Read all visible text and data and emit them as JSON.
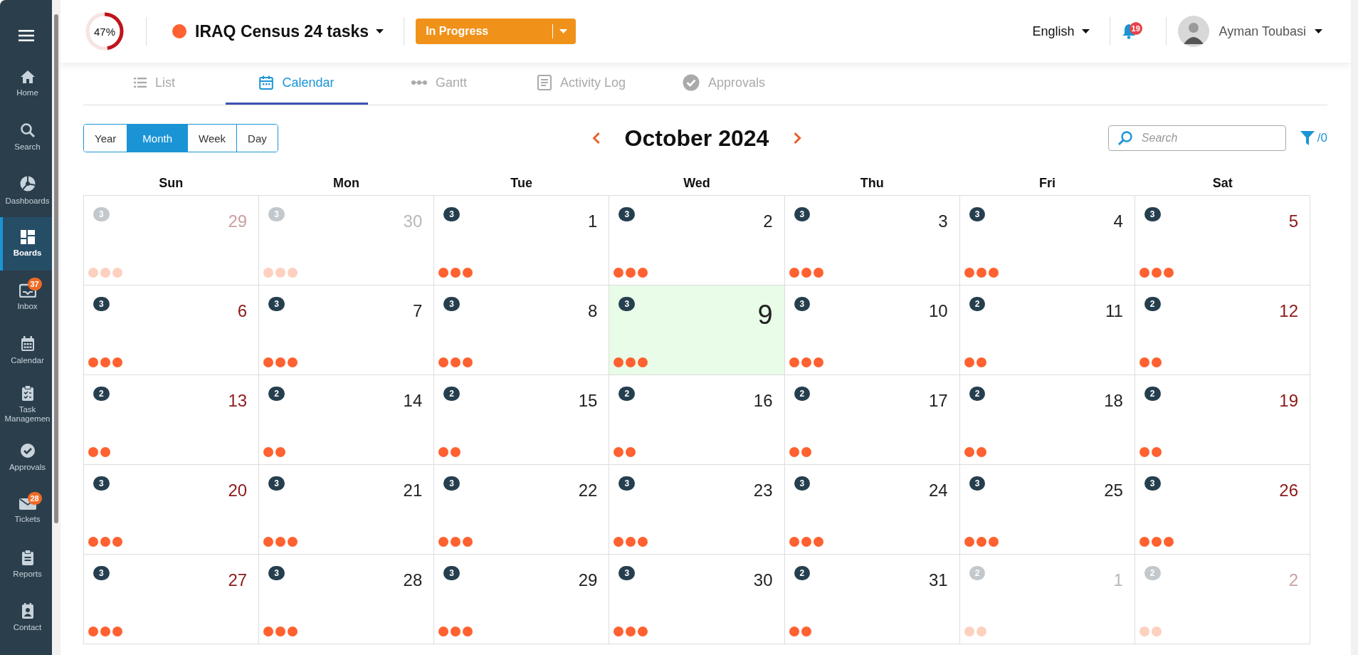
{
  "sidebar": {
    "items": [
      {
        "kind": "home",
        "label": "Home",
        "selected": false
      },
      {
        "kind": "search",
        "label": "Search",
        "selected": false
      },
      {
        "kind": "pie",
        "label": "Dashboards",
        "selected": false
      },
      {
        "kind": "boards",
        "label": "Boards",
        "selected": true
      },
      {
        "kind": "inbox",
        "label": "Inbox",
        "selected": false,
        "badge": "37"
      },
      {
        "kind": "calendar",
        "label": "Calendar",
        "selected": false
      },
      {
        "kind": "clipboard",
        "label": "Task Managemen",
        "selected": false
      },
      {
        "kind": "check",
        "label": "Approvals",
        "selected": false
      },
      {
        "kind": "mail",
        "label": "Tickets",
        "selected": false,
        "badge": "28"
      },
      {
        "kind": "report",
        "label": "Reports",
        "selected": false
      },
      {
        "kind": "contact",
        "label": "Contact",
        "selected": false
      }
    ]
  },
  "header": {
    "progress": {
      "level": 0.47,
      "text": "47%"
    },
    "project": {
      "title": "IRAQ Census 24 tasks",
      "color": "#ff6130"
    },
    "status": "In Progress",
    "language": "English",
    "notifications": "19",
    "user": "Ayman Toubasi"
  },
  "tabs": [
    {
      "kind": "list",
      "label": "List",
      "selected": false
    },
    {
      "kind": "calendar",
      "label": "Calendar",
      "selected": true
    },
    {
      "kind": "gantt",
      "label": "Gantt",
      "selected": false
    },
    {
      "kind": "log",
      "label": "Activity Log",
      "selected": false
    },
    {
      "kind": "check",
      "label": "Approvals",
      "selected": false
    }
  ],
  "views": [
    {
      "label": "Year",
      "selected": false
    },
    {
      "label": "Month",
      "selected": true
    },
    {
      "label": "Week",
      "selected": false
    },
    {
      "label": "Day",
      "selected": false
    }
  ],
  "calendar": {
    "title": "October 2024",
    "search_placeholder": "Search",
    "filter_count": "/0",
    "weekdays": [
      "Sun",
      "Mon",
      "Tue",
      "Wed",
      "Thu",
      "Fri",
      "Sat"
    ],
    "days": [
      {
        "day": "29",
        "count": "3",
        "outside": true,
        "weekend": true,
        "selected": false
      },
      {
        "day": "30",
        "count": "3",
        "outside": true,
        "weekend": false,
        "selected": false
      },
      {
        "day": "1",
        "count": "3",
        "outside": false,
        "weekend": false,
        "selected": false
      },
      {
        "day": "2",
        "count": "3",
        "outside": false,
        "weekend": false,
        "selected": false
      },
      {
        "day": "3",
        "count": "3",
        "outside": false,
        "weekend": false,
        "selected": false
      },
      {
        "day": "4",
        "count": "3",
        "outside": false,
        "weekend": false,
        "selected": false
      },
      {
        "day": "5",
        "count": "3",
        "outside": false,
        "weekend": true,
        "selected": false
      },
      {
        "day": "6",
        "count": "3",
        "outside": false,
        "weekend": true,
        "selected": false
      },
      {
        "day": "7",
        "count": "3",
        "outside": false,
        "weekend": false,
        "selected": false
      },
      {
        "day": "8",
        "count": "3",
        "outside": false,
        "weekend": false,
        "selected": false
      },
      {
        "day": "9",
        "count": "3",
        "outside": false,
        "weekend": false,
        "selected": true
      },
      {
        "day": "10",
        "count": "3",
        "outside": false,
        "weekend": false,
        "selected": false
      },
      {
        "day": "11",
        "count": "2",
        "outside": false,
        "weekend": false,
        "selected": false
      },
      {
        "day": "12",
        "count": "2",
        "outside": false,
        "weekend": true,
        "selected": false
      },
      {
        "day": "13",
        "count": "2",
        "outside": false,
        "weekend": true,
        "selected": false
      },
      {
        "day": "14",
        "count": "2",
        "outside": false,
        "weekend": false,
        "selected": false
      },
      {
        "day": "15",
        "count": "2",
        "outside": false,
        "weekend": false,
        "selected": false
      },
      {
        "day": "16",
        "count": "2",
        "outside": false,
        "weekend": false,
        "selected": false
      },
      {
        "day": "17",
        "count": "2",
        "outside": false,
        "weekend": false,
        "selected": false
      },
      {
        "day": "18",
        "count": "2",
        "outside": false,
        "weekend": false,
        "selected": false
      },
      {
        "day": "19",
        "count": "2",
        "outside": false,
        "weekend": true,
        "selected": false
      },
      {
        "day": "20",
        "count": "3",
        "outside": false,
        "weekend": true,
        "selected": false
      },
      {
        "day": "21",
        "count": "3",
        "outside": false,
        "weekend": false,
        "selected": false
      },
      {
        "day": "22",
        "count": "3",
        "outside": false,
        "weekend": false,
        "selected": false
      },
      {
        "day": "23",
        "count": "3",
        "outside": false,
        "weekend": false,
        "selected": false
      },
      {
        "day": "24",
        "count": "3",
        "outside": false,
        "weekend": false,
        "selected": false
      },
      {
        "day": "25",
        "count": "3",
        "outside": false,
        "weekend": false,
        "selected": false
      },
      {
        "day": "26",
        "count": "3",
        "outside": false,
        "weekend": true,
        "selected": false
      },
      {
        "day": "27",
        "count": "3",
        "outside": false,
        "weekend": true,
        "selected": false
      },
      {
        "day": "28",
        "count": "3",
        "outside": false,
        "weekend": false,
        "selected": false
      },
      {
        "day": "29",
        "count": "3",
        "outside": false,
        "weekend": false,
        "selected": false
      },
      {
        "day": "30",
        "count": "3",
        "outside": false,
        "weekend": false,
        "selected": false
      },
      {
        "day": "31",
        "count": "2",
        "outside": false,
        "weekend": false,
        "selected": false
      },
      {
        "day": "1",
        "count": "2",
        "outside": true,
        "weekend": false,
        "selected": false
      },
      {
        "day": "2",
        "count": "2",
        "outside": true,
        "weekend": true,
        "selected": false
      }
    ]
  }
}
